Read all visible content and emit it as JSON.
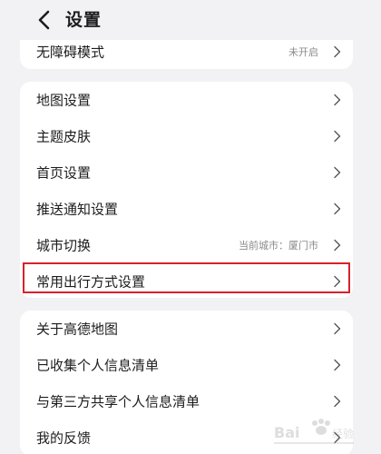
{
  "header": {
    "back_icon": "back-arrow-icon",
    "title": "设置"
  },
  "group1": {
    "items": [
      {
        "label": "无障碍模式",
        "value": "未开启"
      }
    ]
  },
  "group2": {
    "items": [
      {
        "label": "地图设置"
      },
      {
        "label": "主题皮肤"
      },
      {
        "label": "首页设置"
      },
      {
        "label": "推送通知设置"
      },
      {
        "label": "城市切换",
        "value": "当前城市：厦门市"
      },
      {
        "label": "常用出行方式设置",
        "highlighted": true
      }
    ]
  },
  "group3": {
    "items": [
      {
        "label": "关于高德地图"
      },
      {
        "label": "已收集个人信息清单"
      },
      {
        "label": "与第三方共享个人信息清单"
      },
      {
        "label": "我的反馈"
      }
    ]
  },
  "chevron_icon": "chevron-right-icon",
  "highlight_color": "#d9212b",
  "watermark": {
    "text": "Baidu 经验"
  }
}
